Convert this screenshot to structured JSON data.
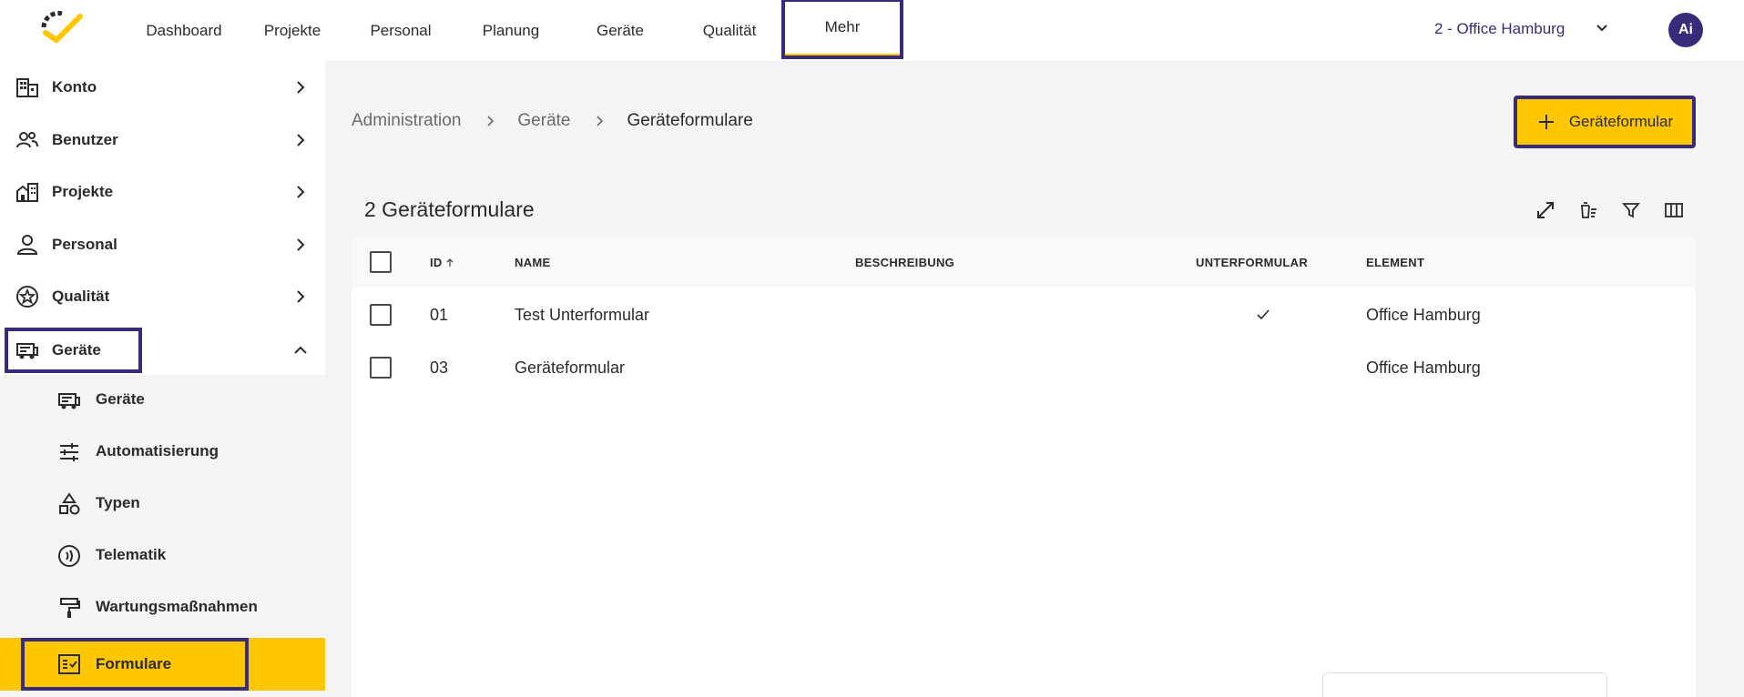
{
  "nav": {
    "items": [
      {
        "label": "Dashboard"
      },
      {
        "label": "Projekte"
      },
      {
        "label": "Personal"
      },
      {
        "label": "Planung"
      },
      {
        "label": "Geräte"
      },
      {
        "label": "Qualität"
      },
      {
        "label": "Mehr"
      }
    ],
    "office": "2 - Office Hamburg",
    "avatar": "Ai"
  },
  "sidebar": {
    "items": [
      {
        "label": "Konto",
        "icon": "building-icon"
      },
      {
        "label": "Benutzer",
        "icon": "users-icon"
      },
      {
        "label": "Projekte",
        "icon": "city-icon"
      },
      {
        "label": "Personal",
        "icon": "person-icon"
      },
      {
        "label": "Qualität",
        "icon": "star-badge-icon"
      },
      {
        "label": "Geräte",
        "icon": "rv-icon"
      }
    ],
    "sub_items": [
      {
        "label": "Geräte",
        "icon": "rv-icon"
      },
      {
        "label": "Automatisierung",
        "icon": "tune-icon"
      },
      {
        "label": "Typen",
        "icon": "shapes-icon"
      },
      {
        "label": "Telematik",
        "icon": "signal-icon"
      },
      {
        "label": "Wartungsmaßnahmen",
        "icon": "paint-roller-icon"
      },
      {
        "label": "Formulare",
        "icon": "form-check-icon"
      }
    ]
  },
  "breadcrumb": {
    "items": [
      "Administration",
      "Geräte",
      "Geräteformulare"
    ]
  },
  "add_button": {
    "label": "Geräteformular"
  },
  "table": {
    "title": "2 Geräteformulare",
    "columns": {
      "id": "ID",
      "name": "NAME",
      "description": "BESCHREIBUNG",
      "subform": "UNTERFORMULAR",
      "element": "ELEMENT"
    },
    "rows": [
      {
        "id": "01",
        "name": "Test Unterformular",
        "description": "",
        "subform": true,
        "element": "Office Hamburg"
      },
      {
        "id": "03",
        "name": "Geräteformular",
        "description": "",
        "subform": false,
        "element": "Office Hamburg"
      }
    ]
  },
  "colors": {
    "accent": "#ffc700",
    "brand": "#3a2a7a",
    "background": "#f4f4f4"
  }
}
